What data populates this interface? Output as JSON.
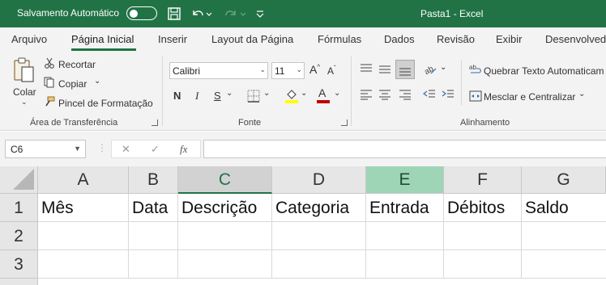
{
  "titlebar": {
    "autosave_label": "Salvamento Automático",
    "autosave_state": "off",
    "window_title": "Pasta1  -  Excel",
    "icons": [
      "save-icon",
      "undo-icon",
      "redo-icon",
      "customize-qat-icon"
    ]
  },
  "tabs": [
    {
      "label": "Arquivo",
      "active": false
    },
    {
      "label": "Página Inicial",
      "active": true
    },
    {
      "label": "Inserir",
      "active": false
    },
    {
      "label": "Layout da Página",
      "active": false
    },
    {
      "label": "Fórmulas",
      "active": false
    },
    {
      "label": "Dados",
      "active": false
    },
    {
      "label": "Revisão",
      "active": false
    },
    {
      "label": "Exibir",
      "active": false
    },
    {
      "label": "Desenvolved",
      "active": false
    }
  ],
  "ribbon": {
    "clipboard": {
      "paste_label": "Colar",
      "cut_label": "Recortar",
      "copy_label": "Copiar",
      "format_painter_label": "Pincel de Formatação",
      "group_label": "Área de Transferência"
    },
    "font": {
      "font_name": "Calibri",
      "font_size": "11",
      "bold": "N",
      "italic": "I",
      "underline": "S",
      "group_label": "Fonte",
      "highlight_color": "#ffff00",
      "font_color": "#c00000"
    },
    "alignment": {
      "wrap_label": "Quebrar Texto Automaticam",
      "merge_label": "Mesclar e Centralizar",
      "group_label": "Alinhamento"
    }
  },
  "formula_bar": {
    "name_box": "C6",
    "cancel_symbol": "✕",
    "enter_symbol": "✓",
    "fx_symbol": "fx",
    "formula": ""
  },
  "sheet": {
    "columns": [
      "A",
      "B",
      "C",
      "D",
      "E",
      "F",
      "G"
    ],
    "rows": [
      {
        "num": "1",
        "cells": [
          "Mês",
          "Data",
          "Descrição",
          "Categoria",
          "Entrada",
          "Débitos",
          "Saldo"
        ]
      },
      {
        "num": "2",
        "cells": [
          "",
          "",
          "",
          "",
          "",
          "",
          ""
        ]
      },
      {
        "num": "3",
        "cells": [
          "",
          "",
          "",
          "",
          "",
          "",
          ""
        ]
      }
    ]
  },
  "colors": {
    "brand": "#217346",
    "highlight_column": "#9fd5b7"
  }
}
